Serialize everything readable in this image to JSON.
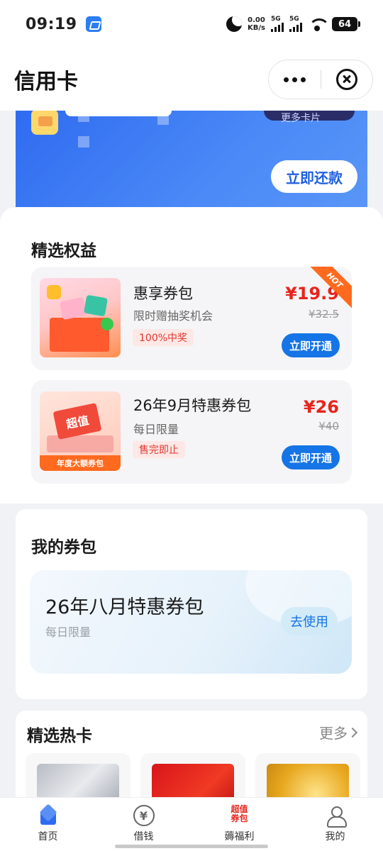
{
  "status_bar": {
    "time": "09:19",
    "net_speed_value": "0.00",
    "net_speed_unit": "KB/s",
    "sim1": "5G",
    "sim2": "5G",
    "battery": "64"
  },
  "header": {
    "title": "信用卡"
  },
  "banner": {
    "pill_text": "更多卡片",
    "repay_label": "立即还款",
    "background_color": "#3d7bf4"
  },
  "benefits": {
    "title": "精选权益",
    "items": [
      {
        "name": "惠享券包",
        "subtitle": "限时赠抽奖机会",
        "tag": "100%中奖",
        "price": "¥19.9",
        "old_price": "¥32.5",
        "badge": "HOT",
        "button": "立即开通"
      },
      {
        "name": "26年9月特惠券包",
        "subtitle": "每日限量",
        "tag": "售完即止",
        "price": "¥26",
        "old_price": "¥40",
        "image_caption": "年度大额券包",
        "image_badge": "超值",
        "button": "立即开通"
      }
    ]
  },
  "wallet": {
    "title": "我的券包",
    "voucher": {
      "name": "26年八月特惠券包",
      "subtitle": "每日限量",
      "button": "去使用"
    }
  },
  "hot_cards": {
    "title": "精选热卡",
    "more": "更多"
  },
  "tab_bar": {
    "items": [
      {
        "label": "首页",
        "icon": "home-icon"
      },
      {
        "label": "借钱",
        "icon": "yen-icon"
      },
      {
        "label": "薅福利",
        "icon": "promo-icon",
        "icon_text_line1": "超值",
        "icon_text_line2": "券包"
      },
      {
        "label": "我的",
        "icon": "person-icon"
      }
    ]
  },
  "colors": {
    "accent": "#1574e6",
    "price_red": "#e8241c",
    "hot_orange": "#ff6a1f"
  }
}
